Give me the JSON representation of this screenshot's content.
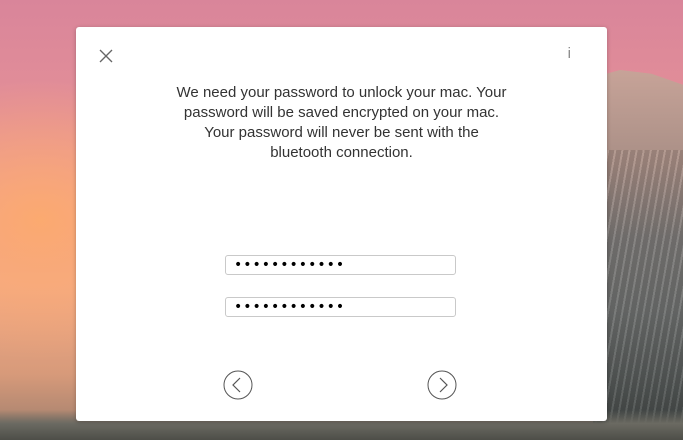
{
  "dialog": {
    "message": "We need your password to unlock your mac. Your password will be saved encrypted on your mac. Your password will never be sent with the bluetooth connection.",
    "info_label": "i",
    "password_field_1": {
      "value": "••••••••••••"
    },
    "password_field_2": {
      "value": "••••••••••••"
    }
  },
  "icons": {
    "close": "close-icon",
    "info": "info-icon",
    "back": "chevron-left-circle-icon",
    "next": "chevron-right-circle-icon"
  }
}
